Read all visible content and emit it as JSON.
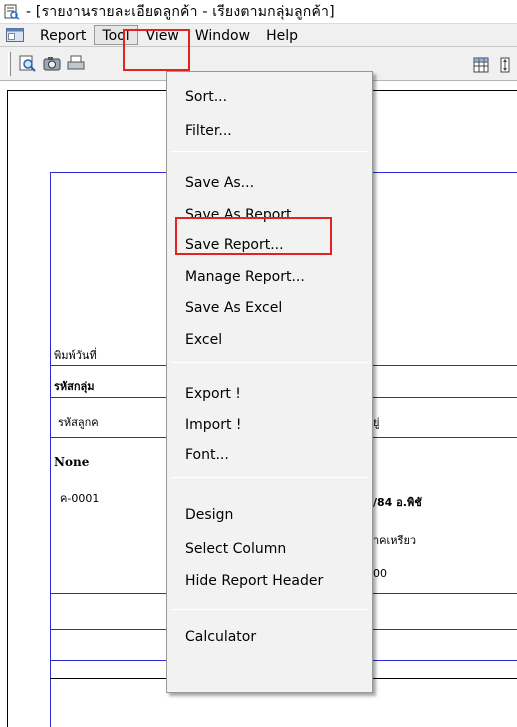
{
  "window": {
    "title": "- [รายงานรายละเอียดลูกค้า - เรียงตามกลุ่มลูกค้า]"
  },
  "menubar": {
    "items": [
      {
        "label": "Report"
      },
      {
        "label": "Tool"
      },
      {
        "label": "View"
      },
      {
        "label": "Window"
      },
      {
        "label": "Help"
      }
    ]
  },
  "toolbar": {
    "icons": [
      "preview-icon",
      "camera-icon",
      "print-icon",
      "grid-icon",
      "column-icon"
    ]
  },
  "report": {
    "print_date_label": "พิมพ์วันที่",
    "group_code_label": "รหัสกลุ่ม",
    "customer_code_label": "รหัสลูกค",
    "address_partial": "ยู่",
    "group_value": "None",
    "customer_code": "ค-0001",
    "address_line1": "/84 อ.พิชั",
    "address_line2": "าคเหรียว",
    "address_line3": "00"
  },
  "tool_menu": {
    "items": [
      {
        "label": "Sort..."
      },
      {
        "label": "Filter..."
      },
      {
        "label": "Save As..."
      },
      {
        "label": "Save As Report..."
      },
      {
        "label": "Save Report..."
      },
      {
        "label": "Manage Report..."
      },
      {
        "label": "Save As Excel"
      },
      {
        "label": "Excel"
      },
      {
        "label": "Export !"
      },
      {
        "label": "Import !"
      },
      {
        "label": "Font..."
      },
      {
        "label": "Design"
      },
      {
        "label": "Select Column"
      },
      {
        "label": "Hide Report Header"
      },
      {
        "label": "Calculator"
      }
    ]
  },
  "colors": {
    "highlight": "#e32222",
    "report_line": "#2b2bd6",
    "menu_bg": "#f2f2f2"
  }
}
